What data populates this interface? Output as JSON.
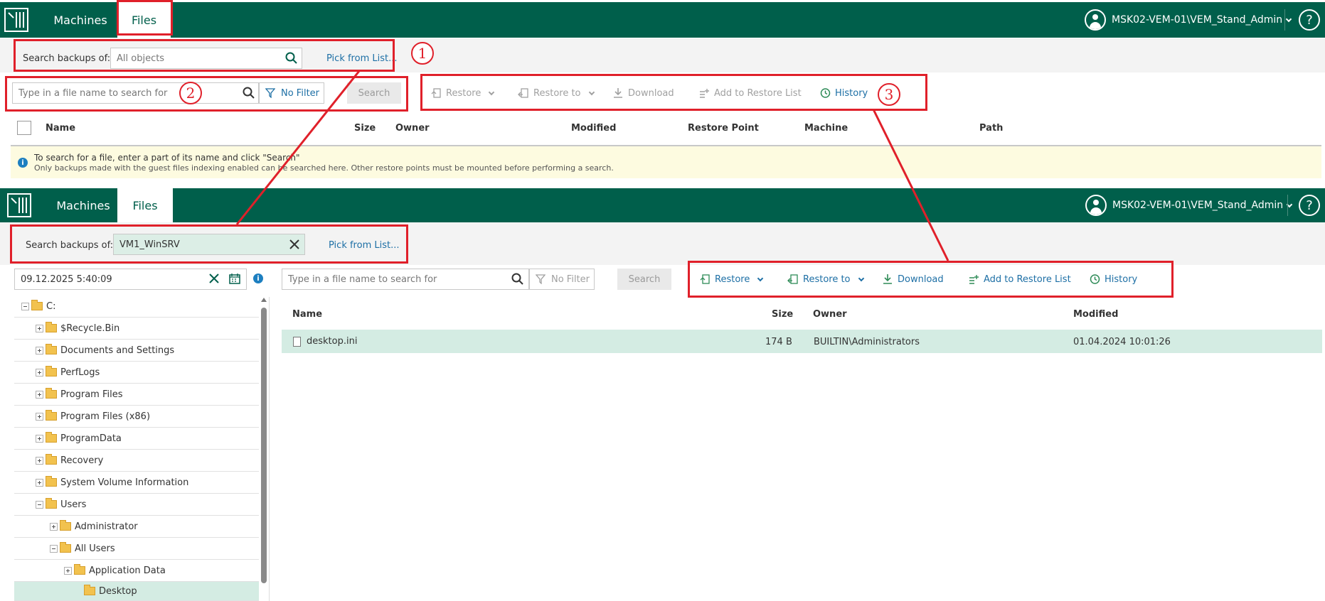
{
  "top": {
    "nav": {
      "machines": "Machines",
      "files": "Files"
    },
    "user": "MSK02-VEM-01\\VEM_Stand_Admin",
    "help": "?",
    "search_backups_label": "Search backups of:",
    "search_backups_value": "All objects",
    "pick_from_list": "Pick from List...",
    "file_search_placeholder": "Type in a file name to search for",
    "no_filter": "No Filter",
    "search_button": "Search",
    "toolbar": {
      "restore": "Restore",
      "restore_to": "Restore to",
      "download": "Download",
      "add_to_restore_list": "Add to Restore List",
      "history": "History"
    },
    "columns": [
      "Name",
      "Size",
      "Owner",
      "Modified",
      "Restore Point",
      "Machine",
      "Path"
    ],
    "info_line1": "To search for a file, enter a part of its name and click \"Search\"",
    "info_line2": "Only backups made with the guest files indexing enabled can be searched here. Other restore points must be mounted before performing a search."
  },
  "bottom": {
    "nav": {
      "machines": "Machines",
      "files": "Files"
    },
    "user": "MSK02-VEM-01\\VEM_Stand_Admin",
    "help": "?",
    "search_backups_label": "Search backups of:",
    "search_backups_value": "VM1_WinSRV",
    "pick_from_list": "Pick from List...",
    "restore_point": "09.12.2025 5:40:09",
    "file_search_placeholder": "Type in a file name to search for",
    "no_filter": "No Filter",
    "search_button": "Search",
    "toolbar": {
      "restore": "Restore",
      "restore_to": "Restore to",
      "download": "Download",
      "add_to_restore_list": "Add to Restore List",
      "history": "History"
    },
    "columns": [
      "Name",
      "Size",
      "Owner",
      "Modified"
    ],
    "tree": [
      "C:",
      "$Recycle.Bin",
      "Documents and Settings",
      "PerfLogs",
      "Program Files",
      "Program Files (x86)",
      "ProgramData",
      "Recovery",
      "System Volume Information",
      "Users",
      "Administrator",
      "All Users",
      "Application Data",
      "Desktop"
    ],
    "files": [
      {
        "name": "desktop.ini",
        "size": "174 B",
        "owner": "BUILTIN\\Administrators",
        "modified": "01.04.2024 10:01:26"
      }
    ]
  },
  "callouts": [
    "1",
    "2",
    "3"
  ],
  "colors": {
    "header": "#005f4b",
    "annotation": "#e0202a",
    "link": "#1d6fa5",
    "selected_row": "#d4ece3",
    "info_bar": "#fdfbe0"
  }
}
